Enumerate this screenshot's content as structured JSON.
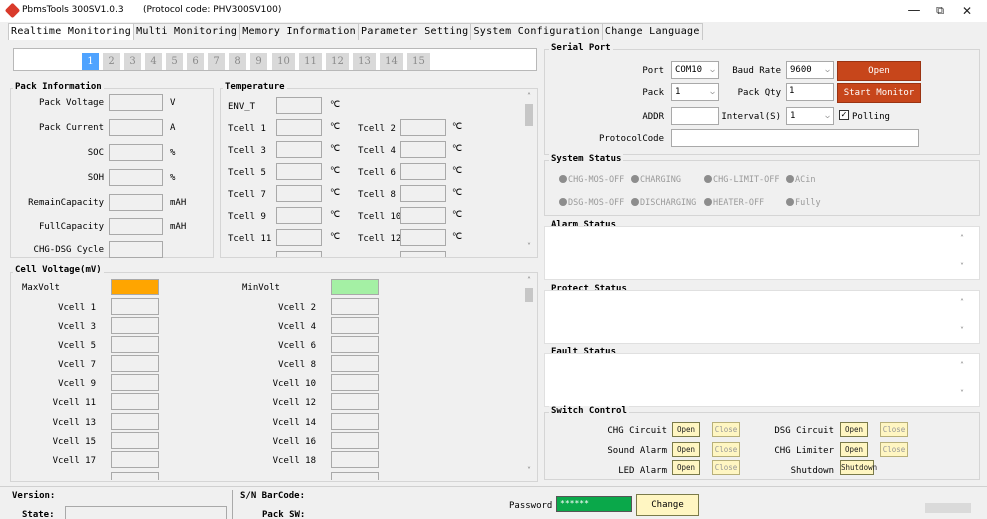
{
  "window": {
    "title": "PbmsTools 300SV1.0.3",
    "protocol": "(Protocol code: PHV300SV100)",
    "minimize": "—",
    "maximize": "⧉",
    "close": "✕"
  },
  "tabs": [
    {
      "label": "Realtime Monitoring",
      "active": true
    },
    {
      "label": "Multi Monitoring"
    },
    {
      "label": "Memory Information"
    },
    {
      "label": "Parameter Setting"
    },
    {
      "label": "System Configuration"
    },
    {
      "label": "Change Language"
    }
  ],
  "pages": [
    "1",
    "2",
    "3",
    "4",
    "5",
    "6",
    "7",
    "8",
    "9",
    "10",
    "11",
    "12",
    "13",
    "14",
    "15"
  ],
  "pack_info": {
    "title": "Pack Information",
    "rows": [
      {
        "label": "Pack Voltage",
        "unit": "V"
      },
      {
        "label": "Pack Current",
        "unit": "A"
      },
      {
        "label": "SOC",
        "unit": "%"
      },
      {
        "label": "SOH",
        "unit": "%"
      },
      {
        "label": "RemainCapacity",
        "unit": "mAH"
      },
      {
        "label": "FullCapacity",
        "unit": "mAH"
      },
      {
        "label": "CHG-DSG Cycle",
        "unit": ""
      }
    ]
  },
  "temperature": {
    "title": "Temperature",
    "env": "ENV_T",
    "unit": "℃",
    "left": [
      "Tcell 1",
      "Tcell 3",
      "Tcell 5",
      "Tcell 7",
      "Tcell 9",
      "Tcell 11"
    ],
    "right": [
      "Tcell 2",
      "Tcell 4",
      "Tcell 6",
      "Tcell 8",
      "Tcell 10",
      "Tcell 12"
    ]
  },
  "cell_voltage": {
    "title": "Cell Voltage(mV)",
    "max": "MaxVolt",
    "min": "MinVolt",
    "max_color": "#ffa500",
    "min_color": "#a4f0a4",
    "left": [
      "Vcell 1",
      "Vcell 3",
      "Vcell 5",
      "Vcell 7",
      "Vcell 9",
      "Vcell 11",
      "Vcell 13",
      "Vcell 15",
      "Vcell 17"
    ],
    "right": [
      "Vcell 2",
      "Vcell 4",
      "Vcell 6",
      "Vcell 8",
      "Vcell 10",
      "Vcell 12",
      "Vcell 14",
      "Vcell 16",
      "Vcell 18"
    ]
  },
  "serial": {
    "title": "Serial Port",
    "port_label": "Port",
    "port_value": "COM10",
    "baud_label": "Baud Rate",
    "baud_value": "9600",
    "open_btn": "Open",
    "pack_label": "Pack",
    "pack_value": "1",
    "packqty_label": "Pack Qty",
    "packqty_value": "1",
    "start_btn": "Start Monitor",
    "addr_label": "ADDR",
    "interval_label": "Interval(S)",
    "interval_value": "1",
    "polling_label": "Polling",
    "protocol_label": "ProtocolCode"
  },
  "system_status": {
    "title": "System Status",
    "row1": [
      "CHG-MOS-OFF",
      "CHARGING",
      "CHG-LIMIT-OFF",
      "ACin"
    ],
    "row2": [
      "DSG-MOS-OFF",
      "DISCHARGING",
      "HEATER-OFF",
      "Fully"
    ]
  },
  "alarm_title": "Alarm Status",
  "protect_title": "Protect Status",
  "fault_title": "Fault Status",
  "switch": {
    "title": "Switch Control",
    "chg": "CHG Circuit",
    "dsg": "DSG Circuit",
    "sound": "Sound Alarm",
    "limiter": "CHG Limiter",
    "led": "LED Alarm",
    "shutdown_label": "Shutdown",
    "open": "Open",
    "close": "Close",
    "shutdown_btn": "Shutdown"
  },
  "footer": {
    "version": "Version:",
    "state": "State:",
    "sn": "S/N BarCode:",
    "packsw": "Pack SW:",
    "password_label": "Password",
    "password_value": "******",
    "change_btn": "Change"
  }
}
